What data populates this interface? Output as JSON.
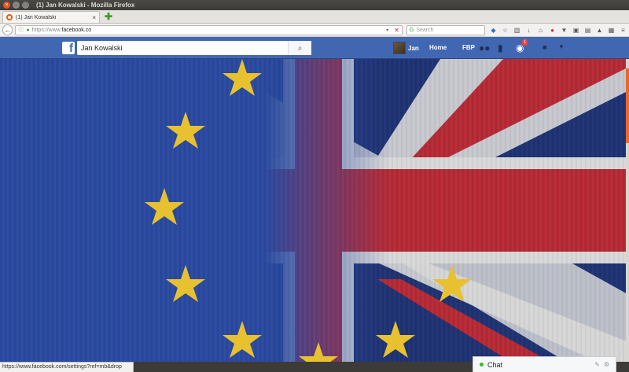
{
  "window": {
    "title": "(1) Jan Kowalski - Mozilla Firefox",
    "close_glyph": "×",
    "min_glyph": "–",
    "max_glyph": "□"
  },
  "tabs": [
    {
      "label": "(1) Jan Kowalski",
      "close_glyph": "×",
      "favicon": "firefox-icon"
    }
  ],
  "newtab_glyph": "✚",
  "navbar": {
    "back_glyph": "←",
    "info_glyph": "ⓘ",
    "lock_glyph": "🔒",
    "url_prefix": "https://www.",
    "url_domain": "facebook.co",
    "dropdown_glyph": "▾",
    "stop_glyph": "✕",
    "search_engine_glyph": "G",
    "search_placeholder": "Search",
    "toolbar_icons": [
      {
        "name": "pocket-icon",
        "glyph": "◆"
      },
      {
        "name": "star-icon",
        "glyph": "☆"
      },
      {
        "name": "library-icon",
        "glyph": "▥"
      },
      {
        "name": "download-icon",
        "glyph": "↓"
      },
      {
        "name": "home-icon",
        "glyph": "⌂"
      },
      {
        "name": "abp-icon",
        "glyph": "●"
      },
      {
        "name": "sync-icon",
        "glyph": "▼"
      },
      {
        "name": "screenshot-icon",
        "glyph": "▣"
      },
      {
        "name": "extension-icon",
        "glyph": "▤"
      },
      {
        "name": "password-icon",
        "glyph": "▲"
      },
      {
        "name": "reader-icon",
        "glyph": "▦"
      },
      {
        "name": "menu-icon",
        "glyph": "≡"
      }
    ]
  },
  "facebook": {
    "logo_letter": "f",
    "search_value": "Jan Kowalski",
    "search_icon_glyph": "⌕",
    "user_name": "Jan",
    "home_label": "Home",
    "page_label": "FBP",
    "friends_glyph": "👥",
    "messages_glyph": "💬",
    "notifications_glyph": "🌐",
    "notification_count": "1",
    "privacy_glyph": "🔒",
    "account_caret_glyph": "▼"
  },
  "colors": {
    "fb_blue": "#4267b2",
    "eu_blue": "#2a4aa0",
    "eu_star_gold": "#e8c130",
    "uk_red": "#b52a35",
    "uk_white": "#d8d8d8",
    "uk_navy": "#1f3272"
  },
  "status_url": "https://www.facebook.com/settings?ref=mb&drop",
  "chat": {
    "label": "Chat",
    "compose_glyph": "✎",
    "settings_glyph": "⚙"
  }
}
